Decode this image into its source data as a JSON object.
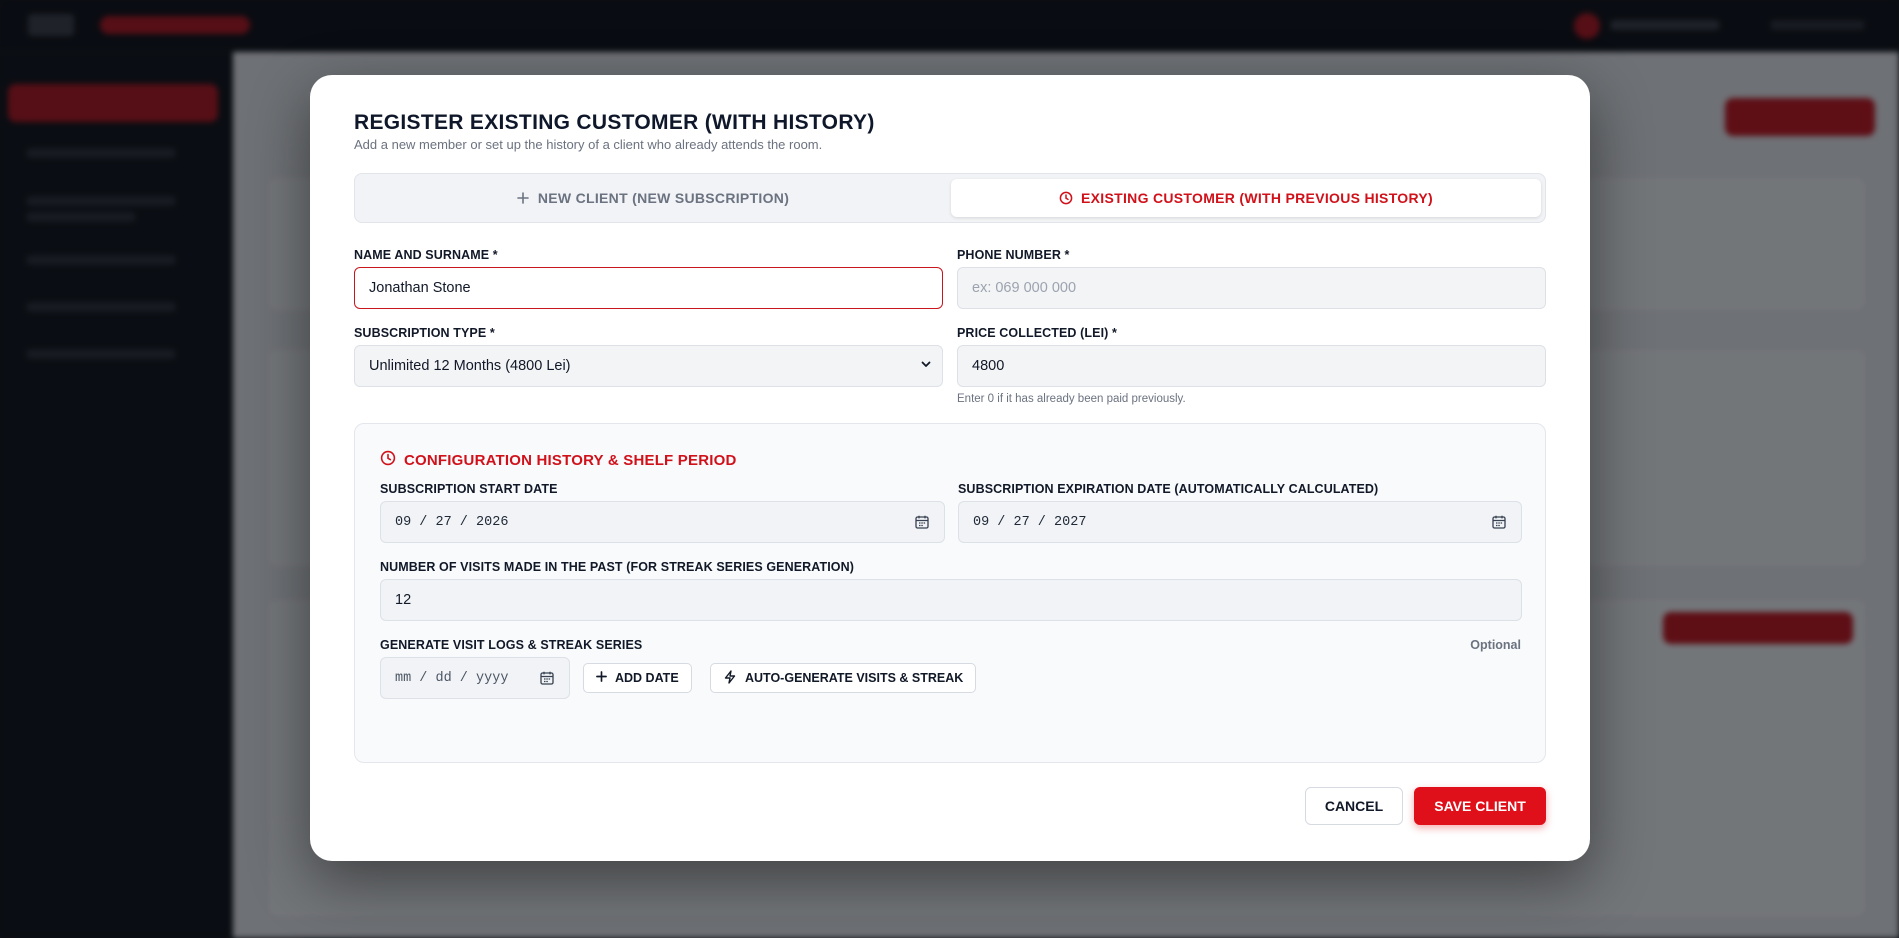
{
  "modal": {
    "title": "REGISTER EXISTING CUSTOMER (WITH HISTORY)",
    "subtitle": "Add a new member or set up the history of a client who already attends the room."
  },
  "tabs": {
    "new_client": "NEW CLIENT (NEW SUBSCRIPTION)",
    "existing_customer": "EXISTING CUSTOMER (WITH PREVIOUS HISTORY)",
    "active": "existing_customer"
  },
  "form": {
    "name": {
      "label": "NAME AND SURNAME *",
      "value": "Jonathan Stone"
    },
    "phone": {
      "label": "PHONE NUMBER *",
      "placeholder": "ex: 069 000 000"
    },
    "subscription_type": {
      "label": "SUBSCRIPTION TYPE *",
      "value": "Unlimited 12 Months (4800 Lei)"
    },
    "price": {
      "label": "PRICE COLLECTED (LEI) *",
      "value": "4800",
      "hint": "Enter 0 if it has already been paid previously."
    }
  },
  "history": {
    "title": "CONFIGURATION HISTORY & SHELF PERIOD",
    "start_date": {
      "label": "SUBSCRIPTION START DATE",
      "value": "09 / 27 / 2026"
    },
    "expiration_date": {
      "label": "SUBSCRIPTION EXPIRATION DATE (AUTOMATICALLY CALCULATED)",
      "value": "09 / 27 / 2027"
    },
    "past_visits": {
      "label": "NUMBER OF VISITS MADE IN THE PAST (FOR STREAK SERIES GENERATION)",
      "value": "12"
    },
    "visit_logs": {
      "label": "GENERATE VISIT LOGS & STREAK SERIES",
      "optional": "Optional",
      "date_placeholder": "mm / dd / yyyy",
      "add_date": "ADD DATE",
      "auto_generate": "AUTO-GENERATE VISITS & STREAK"
    }
  },
  "actions": {
    "cancel": "CANCEL",
    "save": "SAVE CLIENT"
  },
  "colors": {
    "accent": "#e0101a",
    "accent_text": "#d1111a"
  }
}
